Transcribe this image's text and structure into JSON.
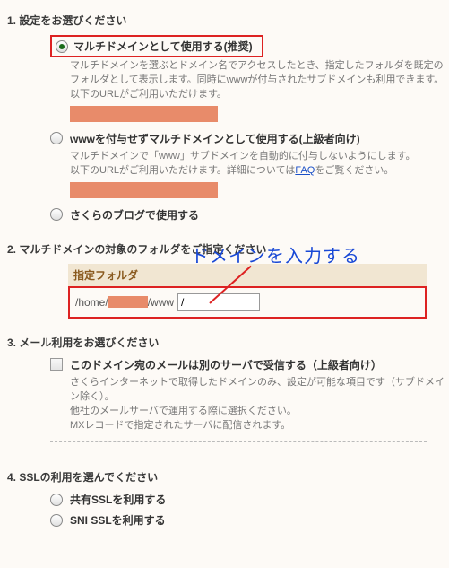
{
  "section1": {
    "title": "1. 設定をお選びください",
    "opt1": {
      "label": "マルチドメインとして使用する(推奨)",
      "desc1": "マルチドメインを選ぶとドメイン名でアクセスしたとき、指定したフォルダを既定のフォルダとして表示します。同時にwwwが付与されたサブドメインも利用できます。",
      "desc2": "以下のURLがご利用いただけます。"
    },
    "opt2": {
      "label": "wwwを付与せずマルチドメインとして使用する(上級者向け)",
      "desc1": "マルチドメインで「www」サブドメインを自動的に付与しないようにします。",
      "desc2a": "以下のURLがご利用いただけます。詳細については",
      "faq": "FAQ",
      "desc2b": "をご覧ください。"
    },
    "opt3": {
      "label": "さくらのブログで使用する"
    }
  },
  "section2": {
    "title": "2. マルチドメインの対象のフォルダをご指定ください",
    "annotation": "ドメインを入力する",
    "folder_header": "指定フォルダ",
    "path_prefix": "/home/",
    "path_suffix": "/www",
    "input_value": "/"
  },
  "section3": {
    "title": "3. メール利用をお選びください",
    "opt1": {
      "label": "このドメイン宛のメールは別のサーバで受信する（上級者向け）",
      "desc1": "さくらインターネットで取得したドメインのみ、設定が可能な項目です（サブドメイン除く）。",
      "desc2": "他社のメールサーバで運用する際に選択ください。",
      "desc3": "MXレコードで指定されたサーバに配信されます。"
    }
  },
  "section4": {
    "title": "4. SSLの利用を選んでください",
    "opt1": {
      "label": "共有SSLを利用する"
    },
    "opt2": {
      "label": "SNI SSLを利用する"
    }
  }
}
